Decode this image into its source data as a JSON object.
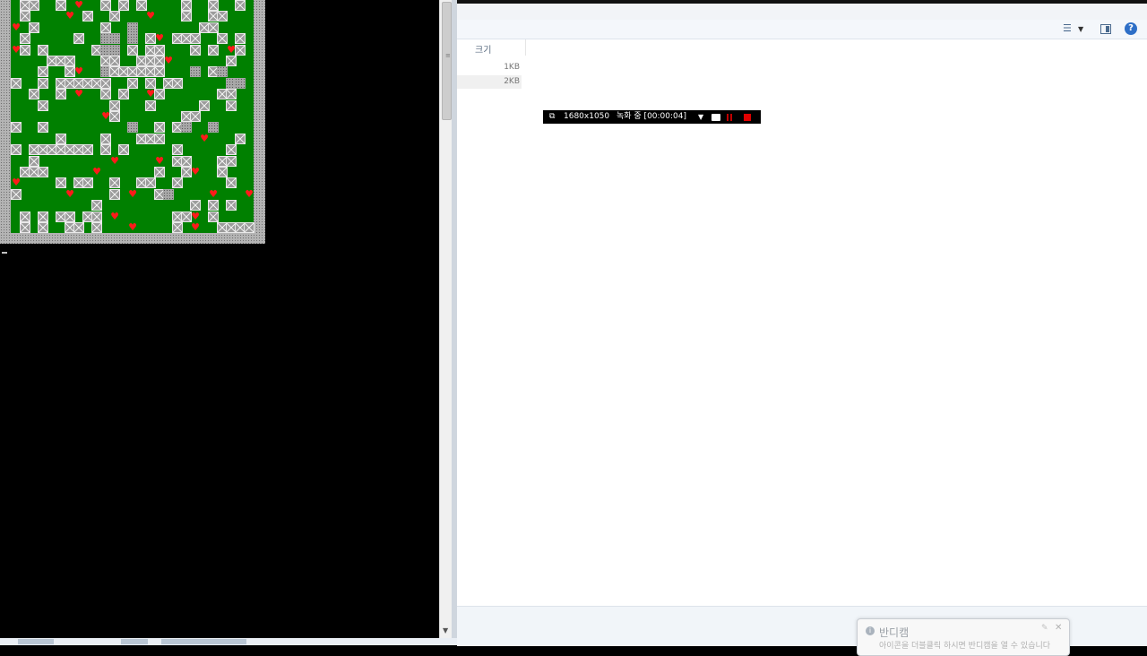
{
  "game": {
    "rows": [
      ".xx..x.h..x.x.x....x..x..x.",
      ".x....h.x..x...h...x..xx...",
      "h.x.......x..w.......xx....",
      ".x.....x..ww.w.xh.xxx..x.x.",
      "hx.x.....xww.x.xx...x.x.hx.",
      "....xxx...xx..xxxh......x..",
      "...x..xh..wxxxxxx...w.xw...",
      "x..x.xxxxxx..x.x.xx.....ww.",
      "..x..x.h..x.x..hx......xx..",
      "...x.......x...x.....x..x..",
      "..........hx.......xx......",
      "x..x.........w..x.xw..w....",
      ".....x....x...xxx....h...x.",
      "x.xxxxxxx.x.x.....x.....x..",
      "..x........h....h.xx...xx..",
      ".xxx.....h......x..xh..x...",
      "h....x.xx..x..xx..x.....x..",
      "x.....h....x.h..xw....h...h",
      ".........x..........x.x.x..",
      ".x.x.xx.xx.h......xxh.x....",
      ".x.x..xx.x...h....x.h..xxxx"
    ]
  },
  "explorer": {
    "column_header": "크기",
    "rows": [
      {
        "size": "1KB"
      },
      {
        "size": "2KB"
      }
    ],
    "toolbar": {
      "views_icon": "views-list-icon",
      "preview_pane_icon": "preview-pane-icon",
      "help_label": "?"
    }
  },
  "recorder": {
    "resolution": "1680x1050",
    "status": "녹화 중 [00:00:04]"
  },
  "toast": {
    "title": "반디캠",
    "message": "아이콘을 더블클릭 하시면 반디캠을 열 수 있습니다"
  },
  "colors": {
    "field_green": "#008000",
    "heart_red": "#ff1a1a",
    "recorder_stop": "#e00000"
  }
}
